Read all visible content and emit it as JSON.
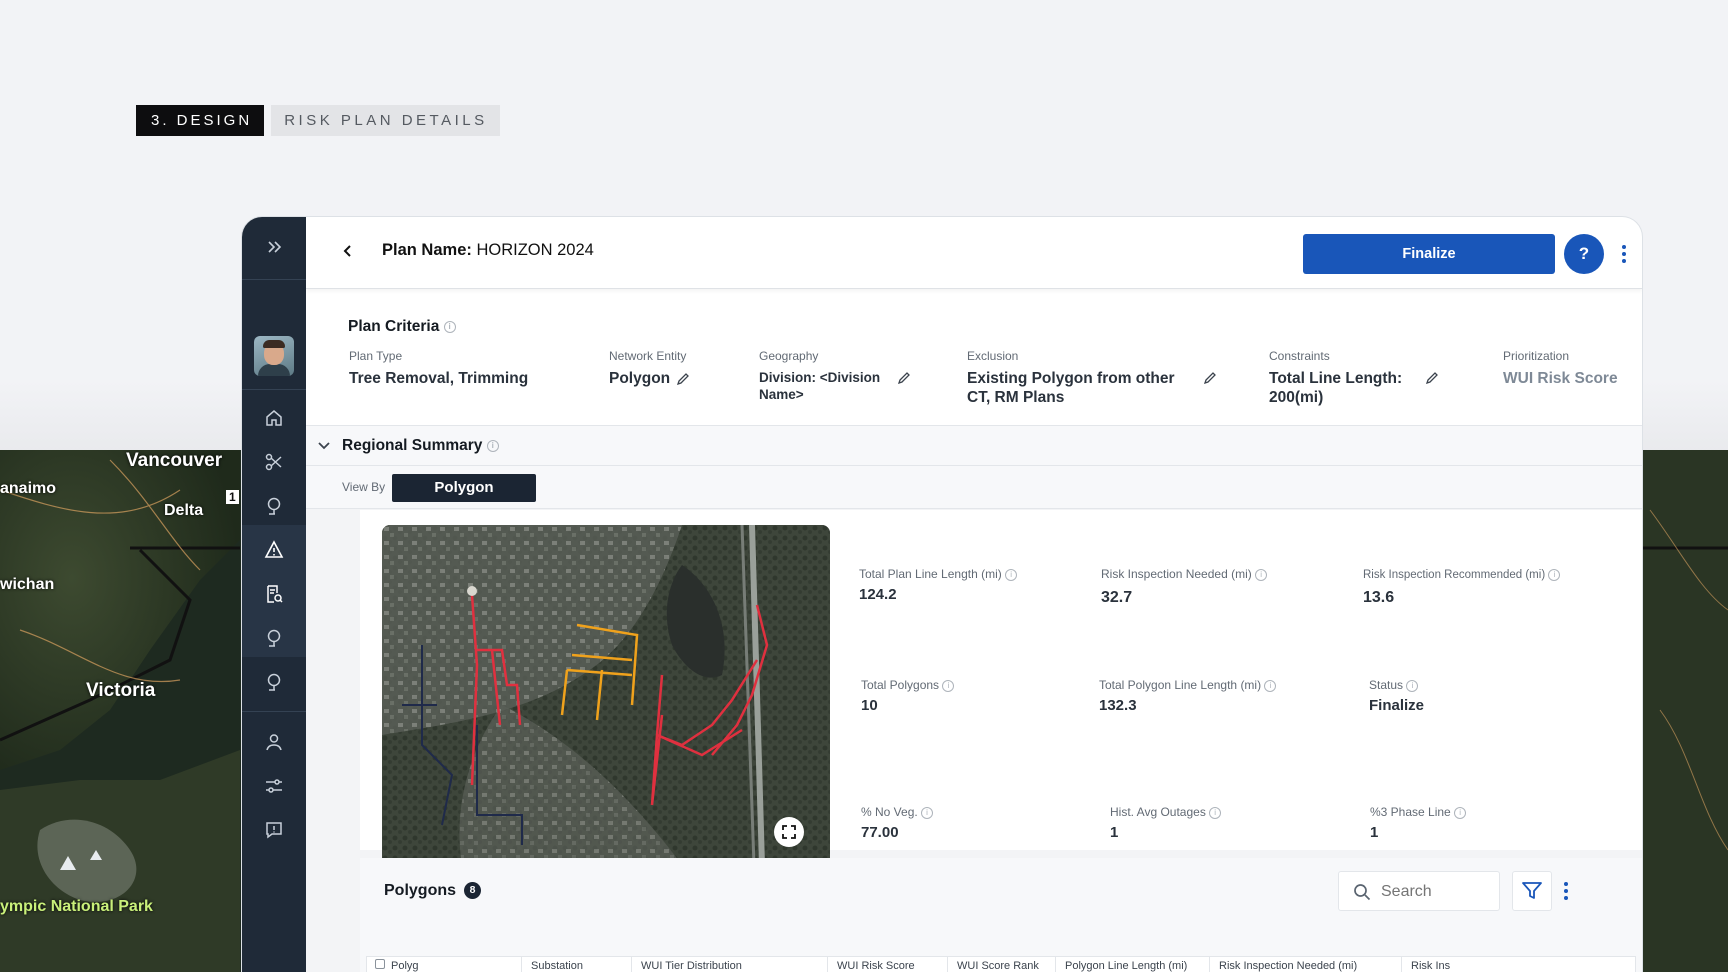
{
  "tag": {
    "step": "3. DESIGN",
    "title": "RISK PLAN DETAILS"
  },
  "bg_map_labels": {
    "vancouver": "Vancouver",
    "nanaimo": "anaimo",
    "delta": "Delta",
    "cowichan": "wichan",
    "victoria": "Victoria",
    "park": "ympic National Park",
    "route": "1"
  },
  "header": {
    "plan_label": "Plan Name:",
    "plan_value": "HORIZON 2024",
    "finalize_label": "Finalize",
    "help_label": "?"
  },
  "criteria": {
    "title": "Plan Criteria",
    "items": [
      {
        "label": "Plan Type",
        "value": "Tree Removal, Trimming"
      },
      {
        "label": "Network Entity",
        "value": "Polygon"
      },
      {
        "label": "Geography",
        "value": "Division: <Division Name>"
      },
      {
        "label": "Exclusion",
        "value": "Existing Polygon from other CT, RM Plans"
      },
      {
        "label": "Constraints",
        "value": "Total Line Length: 200(mi)"
      },
      {
        "label": "Prioritization",
        "value": "WUI Risk Score"
      }
    ]
  },
  "regional": {
    "title": "Regional Summary",
    "view_by_label": "View By",
    "view_by_value": "Polygon"
  },
  "metrics": [
    {
      "label": "Total Plan Line Length (mi)",
      "value": "124.2"
    },
    {
      "label": "Risk Inspection Needed (mi)",
      "value": "32.7"
    },
    {
      "label": "Risk Inspection Recommended (mi)",
      "value": "13.6"
    },
    {
      "label": "Total Polygons",
      "value": "10"
    },
    {
      "label": "Total Polygon Line Length (mi)",
      "value": "132.3"
    },
    {
      "label": "Status",
      "value": "Finalize"
    },
    {
      "label": "% No Veg.",
      "value": "77.00"
    },
    {
      "label": "Hist. Avg Outages",
      "value": "1"
    },
    {
      "label": "%3 Phase Line",
      "value": "1"
    }
  ],
  "polygons": {
    "title": "Polygons",
    "count": "8",
    "search_placeholder": "Search",
    "columns": [
      "Polyg",
      "Substation",
      "WUI Tier Distribution",
      "WUI Risk Score",
      "WUI Score Rank",
      "Polygon Line Length (mi)",
      "Risk Inspection Needed (mi)",
      "Risk Ins"
    ]
  },
  "colors": {
    "primary": "#1956b9",
    "rail": "#1f2a38",
    "line_red": "#e0303f",
    "line_orange": "#f0a21c",
    "line_navy": "#1f2a4a"
  }
}
